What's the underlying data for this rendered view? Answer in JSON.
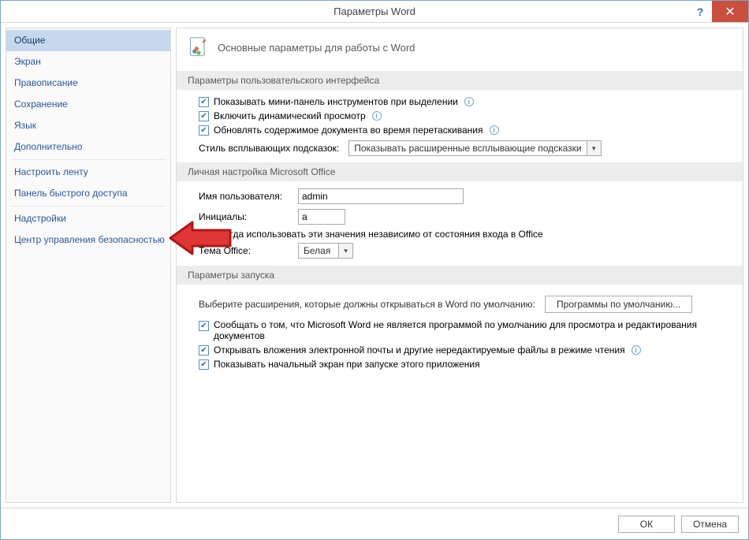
{
  "window": {
    "title": "Параметры Word"
  },
  "sidebar": {
    "items": [
      "Общие",
      "Экран",
      "Правописание",
      "Сохранение",
      "Язык",
      "Дополнительно",
      "Настроить ленту",
      "Панель быстрого доступа",
      "Надстройки",
      "Центр управления безопасностью"
    ],
    "selected_index": 0
  },
  "main": {
    "heading": "Основные параметры для работы с Word",
    "section_ui": {
      "title": "Параметры пользовательского интерфейса",
      "opt_mini_toolbar": "Показывать мини-панель инструментов при выделении",
      "opt_live_preview": "Включить динамический просмотр",
      "opt_update_drag": "Обновлять содержимое документа во время перетаскивания",
      "tooltip_style_label": "Стиль всплывающих подсказок:",
      "tooltip_style_value": "Показывать расширенные всплывающие подсказки"
    },
    "section_personal": {
      "title": "Личная настройка Microsoft Office",
      "username_label": "Имя пользователя:",
      "username_value": "admin",
      "initials_label": "Инициалы:",
      "initials_value": "a",
      "always_use": "Всегда использовать эти значения независимо от состояния входа в Office",
      "theme_label": "Тема Office:",
      "theme_value": "Белая"
    },
    "section_startup": {
      "title": "Параметры запуска",
      "ext_desc": "Выберите расширения, которые должны открываться в Word по умолчанию:",
      "default_programs_btn": "Программы по умолчанию...",
      "opt_not_default": "Сообщать о том, что Microsoft Word не является программой по умолчанию для просмотра и редактирования документов",
      "opt_open_attachments": "Открывать вложения электронной почты и другие нередактируемые файлы в режиме чтения",
      "opt_show_start": "Показывать начальный экран при запуске этого приложения"
    }
  },
  "footer": {
    "ok": "ОК",
    "cancel": "Отмена"
  }
}
